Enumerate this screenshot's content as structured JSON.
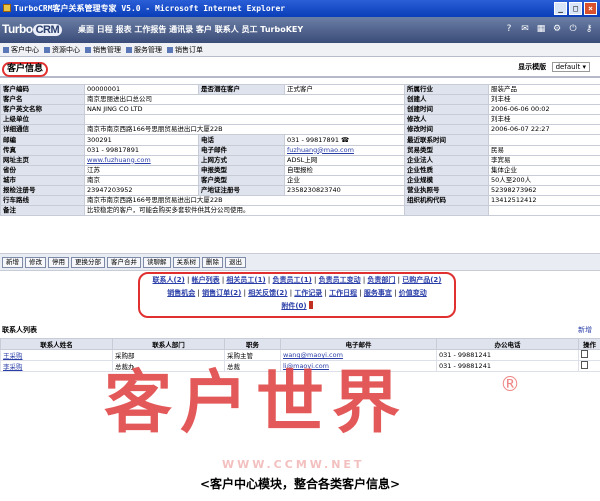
{
  "window": {
    "title": "TurboCRM客户关系管理专家 V5.0 - Microsoft Internet Explorer",
    "minimize": "_",
    "maximize": "□",
    "close": "×"
  },
  "header": {
    "logo_turbo": "Turbo",
    "logo_crm": "CRM",
    "modules": "桌面 日程 报表 工作报告 通讯录 客户 联系人 员工 TurboKEY"
  },
  "nav": {
    "items": [
      "客户中心",
      "资源中心",
      "销售管理",
      "服务管理",
      "销售订单"
    ]
  },
  "page": {
    "title": "客户信息",
    "template_label": "显示模版",
    "template_value": "default"
  },
  "info_rows": [
    [
      "客户编码",
      "00000001",
      "是否潜在客户",
      "正式客户",
      "所属行业",
      "服装产品"
    ],
    [
      "客户名",
      "南京思丽进出口总公司",
      "",
      "",
      "创建人",
      "刘丰桂"
    ],
    [
      "客户英文名称",
      "NAN JING CO LTD",
      "",
      "",
      "创建时间",
      "2006-06-06 00:02"
    ],
    [
      "上级单位",
      "",
      "",
      "",
      "修改人",
      "刘丰桂"
    ],
    [
      "详细通信",
      "南京市南京西路166号思丽贸易进出口大厦22B",
      "",
      "",
      "修改时间",
      "2006-06-07 22:27"
    ],
    [
      "邮编",
      "300291",
      "电话",
      "031 - 99817891 ☎",
      "最近联系时间",
      ""
    ],
    [
      "传真",
      "031 - 99817891",
      "电子邮件",
      "fuzhuang@mao.com",
      "贸易类型",
      "民易"
    ],
    [
      "网址主页",
      "www.fuzhuang.com",
      "上网方式",
      "ADSL上网",
      "企业法人",
      "李宾易"
    ],
    [
      "省份",
      "江苏",
      "申报类型",
      "自理报检",
      "企业性质",
      "集体企业"
    ],
    [
      "城市",
      "南京",
      "客户类型",
      "企业",
      "企业规模",
      "50人至200人"
    ],
    [
      "报检注册号",
      "23947203952",
      "产地证注册号",
      "2358230823740",
      "营业执照号",
      "52398273962"
    ],
    [
      "行车路线",
      "南京市南京西路166号思丽贸易进出口大厦22B",
      "",
      "",
      "组织机构代码",
      "13412512412"
    ],
    [
      "备注",
      "比较稳定的客户，可能会购买多套软件供其分公司使用。",
      "",
      "",
      "",
      ""
    ]
  ],
  "actions": [
    "新增",
    "修改",
    "停用",
    "更换分部",
    "客户合并",
    "读聊解",
    "关系树",
    "删除",
    "退出"
  ],
  "related": {
    "row1": [
      "联系人(2)",
      "帐户列表",
      "相关员工(1)",
      "负责员工(1)",
      "负责员工变动",
      "负责部门",
      "已购产品(2)"
    ],
    "row2": [
      "销售机会",
      "销售订单(2)",
      "相关反馈(2)",
      "工作记录",
      "工作日程",
      "服务事宜",
      "价值变动"
    ],
    "row3": [
      "附件(0)"
    ]
  },
  "contacts": {
    "title": "联系人列表",
    "new_label": "新增",
    "headers": [
      "联系人姓名",
      "联系人部门",
      "职务",
      "电子邮件",
      "办公电话",
      "操作"
    ],
    "rows": [
      [
        "王采购",
        "采购部",
        "采购主管",
        "wang@maoyi.com",
        "031 - 99881241"
      ],
      [
        "李采购",
        "总裁办",
        "总裁",
        "li@maoyi.com",
        "031 - 99881241"
      ]
    ]
  },
  "watermark": {
    "text": "客户世界",
    "reg": "®",
    "url": "WWW.CCMW.NET"
  },
  "caption": "<客户中心模块，整合各类客户信息>"
}
